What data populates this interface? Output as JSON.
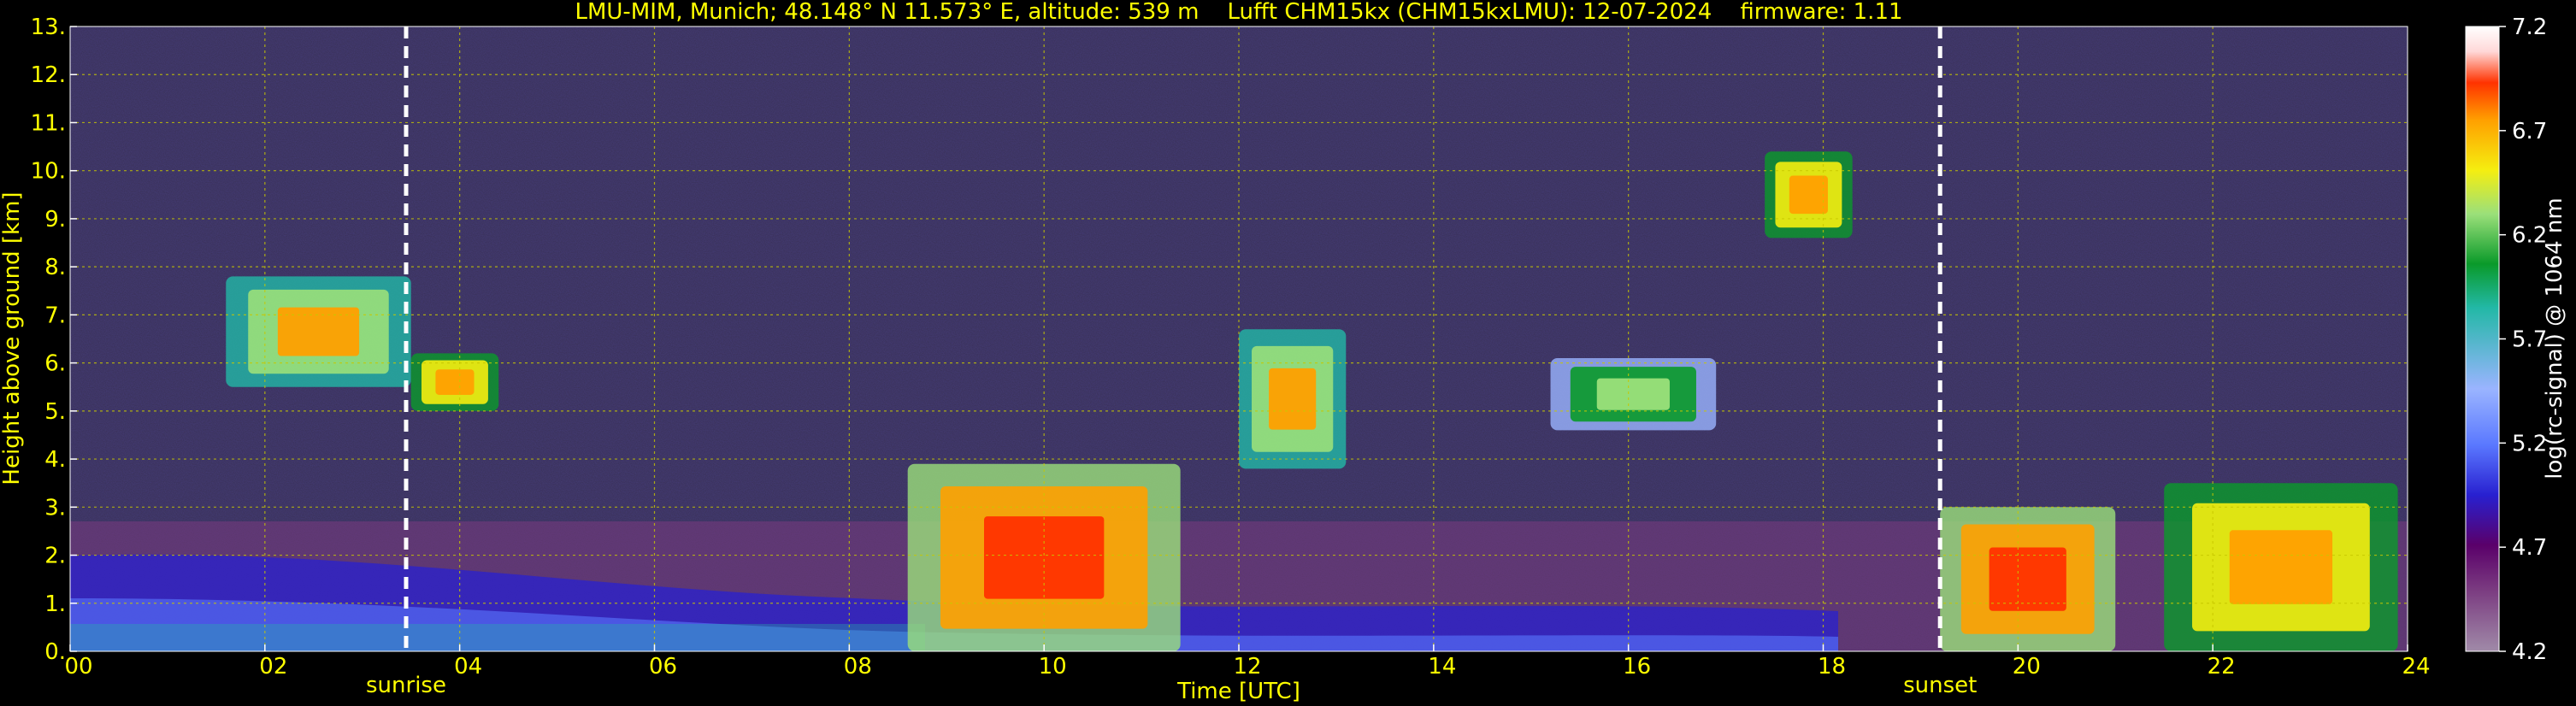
{
  "chart_data": {
    "type": "heatmap",
    "title": "LMU-MIM, Munich; 48.148° N 11.573° E, altitude: 539 m    Lufft CHM15kx (CHM15kxLMU): 12-07-2024    firmware: 1.11",
    "xlabel": "Time [UTC]",
    "ylabel": "Height above ground [km]",
    "colorbar_label": "log(rc-signal) @ 1064 nm",
    "xlim": [
      0,
      24
    ],
    "ylim": [
      0,
      13
    ],
    "x_ticks": [
      "00",
      "02",
      "04",
      "06",
      "08",
      "10",
      "12",
      "14",
      "16",
      "18",
      "20",
      "22",
      "24"
    ],
    "y_ticks": [
      "0.",
      "1.",
      "2.",
      "3.",
      "4.",
      "5.",
      "6.",
      "7.",
      "8.",
      "9.",
      "10.",
      "11.",
      "12.",
      "13."
    ],
    "colorbar_ticks": [
      "4.2",
      "4.7",
      "5.2",
      "5.7",
      "6.2",
      "6.7",
      "7.2"
    ],
    "clim": [
      4.2,
      7.2
    ],
    "grid": true,
    "annotations": [
      {
        "label": "sunrise",
        "x": 3.45
      },
      {
        "label": "sunset",
        "x": 19.2
      }
    ],
    "features": [
      {
        "t0": 1.6,
        "t1": 3.5,
        "h0": 5.5,
        "h1": 7.8,
        "level": 6.6
      },
      {
        "t0": 3.5,
        "t1": 4.4,
        "h0": 5.0,
        "h1": 6.2,
        "level": 6.8
      },
      {
        "t0": 8.6,
        "t1": 11.4,
        "h0": 0.0,
        "h1": 3.9,
        "level": 7.0
      },
      {
        "t0": 12.0,
        "t1": 13.1,
        "h0": 3.8,
        "h1": 6.7,
        "level": 6.6
      },
      {
        "t0": 15.2,
        "t1": 16.9,
        "h0": 4.6,
        "h1": 6.1,
        "level": 6.3
      },
      {
        "t0": 17.4,
        "t1": 18.3,
        "h0": 8.6,
        "h1": 10.4,
        "level": 6.7
      },
      {
        "t0": 19.2,
        "t1": 21.0,
        "h0": 0.0,
        "h1": 3.0,
        "level": 6.9
      },
      {
        "t0": 21.5,
        "t1": 23.9,
        "h0": 0.0,
        "h1": 3.5,
        "level": 6.8
      }
    ]
  },
  "colormap": [
    "#a08aa8",
    "#7a3a80",
    "#5a006a",
    "#2820d0",
    "#5a78ff",
    "#9ab4ff",
    "#22b8a6",
    "#0a9a2a",
    "#9be07a",
    "#f5ee10",
    "#ffa000",
    "#ff3300",
    "#ffffff"
  ],
  "text_color": "#ffff00",
  "colorbar_text_color": "#ffffff"
}
